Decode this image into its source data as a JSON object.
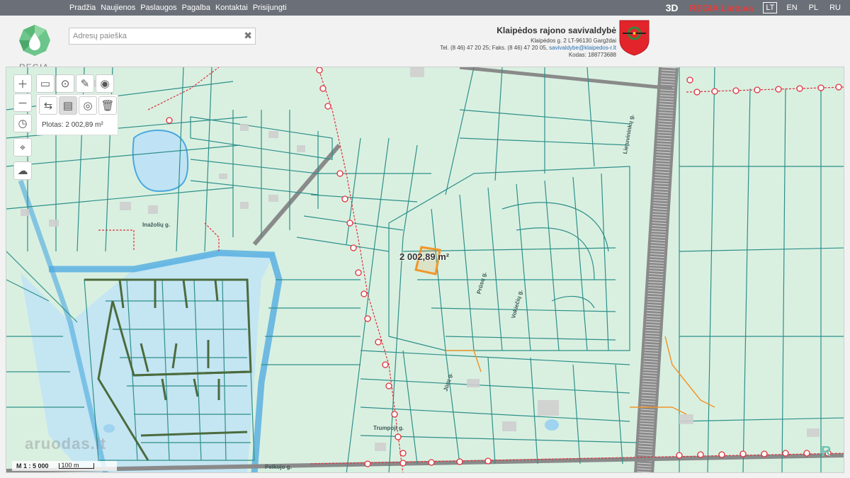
{
  "topnav": {
    "items": [
      "Pradžia",
      "Naujienos",
      "Paslaugos",
      "Pagalba",
      "Kontaktai",
      "Prisijungti"
    ],
    "mode_3d": "3D",
    "regia_link": "REGIA Lietuva",
    "languages": [
      "LT",
      "EN",
      "PL",
      "RU"
    ],
    "active_language": "LT"
  },
  "logo": {
    "text": "REGIA",
    "icon": "regia-drop-icon"
  },
  "search": {
    "placeholder": "Adresų paieška",
    "value": ""
  },
  "municipality": {
    "title": "Klaipėdos rajono savivaldybė",
    "address": "Klaipėdos g. 2 LT-96130 Gargždai",
    "phones": "Tel. (8 46) 47 20 25; Faks. (8 46) 47 20 05,",
    "email": "savivaldybe@klaipedos-r.lt",
    "code": "Kodas: 188773688",
    "crest": "coat-of-arms-icon"
  },
  "map": {
    "area_label": "Plotas: 2 002,89 m²",
    "measure_label": "2 002,89 m²",
    "scale": "M 1 : 5 000",
    "scale_bar": "100 m",
    "watermark": "aruodas.lt",
    "streets": [
      "Inažolių g.",
      "Prūsų g.",
      "Vokiečių g.",
      "Pelkojo g.",
      "Trumpoji g.",
      "Lietuvininkų g.",
      "Jūrų g."
    ],
    "colors": {
      "background": "#d9f0e1",
      "parcel": "#2f8f8a",
      "water": "#9fd3f0",
      "river": "#4aa8e0",
      "power_line": "#e0303a",
      "road": "#8a8a8a",
      "measure": "#f0962a"
    },
    "tools": [
      "zoom-in-icon",
      "zoom-out-icon",
      "compass-icon",
      "locate-icon",
      "shape-icon",
      "ruler-icon",
      "marker-icon",
      "edit-icon",
      "target-icon",
      "measure-line-icon",
      "measure-area-icon",
      "measure-radius-icon",
      "trash-icon"
    ]
  }
}
